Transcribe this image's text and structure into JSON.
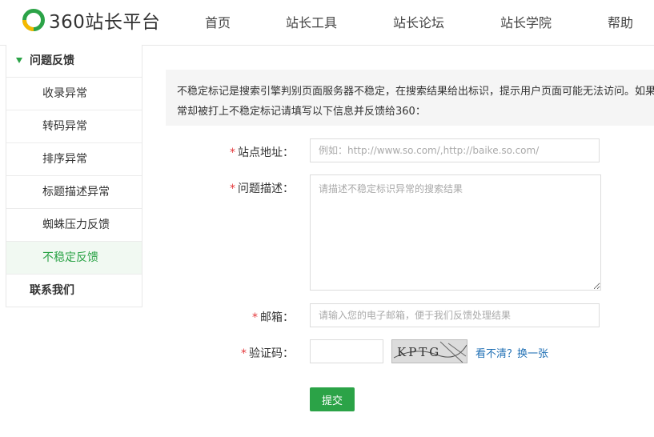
{
  "header": {
    "logo_text": "360站长平台",
    "nav": [
      "首页",
      "站长工具",
      "站长论坛",
      "站长学院",
      "帮助"
    ]
  },
  "sidebar": {
    "section_title": "问题反馈",
    "items": [
      "收录异常",
      "转码异常",
      "排序异常",
      "标题描述异常",
      "蜘蛛压力反馈",
      "不稳定反馈"
    ],
    "active_item": "不稳定反馈",
    "contact": "联系我们"
  },
  "notice": {
    "line1": "不稳定标记是搜索引擎判别页面服务器不稳定，在搜索结果给出标识，提示用户页面可能无法访问。如果",
    "line2": "常却被打上不稳定标记请填写以下信息并反馈给360："
  },
  "form": {
    "required_mark": "*",
    "site_label": "站点地址：",
    "site_placeholder": "例如：http://www.so.com/,http://baike.so.com/",
    "desc_label": "问题描述：",
    "desc_placeholder": "请描述不稳定标识异常的搜索结果",
    "email_label": "邮箱：",
    "email_placeholder": "请输入您的电子邮箱，便于我们反馈处理结果",
    "captcha_label": "验证码：",
    "captcha_text": "KPTG",
    "refresh_label": "看不清？换一张",
    "submit_label": "提交"
  },
  "colors": {
    "brand_green": "#2ba347",
    "logo_yellow": "#f5b800",
    "required_red": "#e4393c",
    "link_blue": "#1f6fb4"
  }
}
